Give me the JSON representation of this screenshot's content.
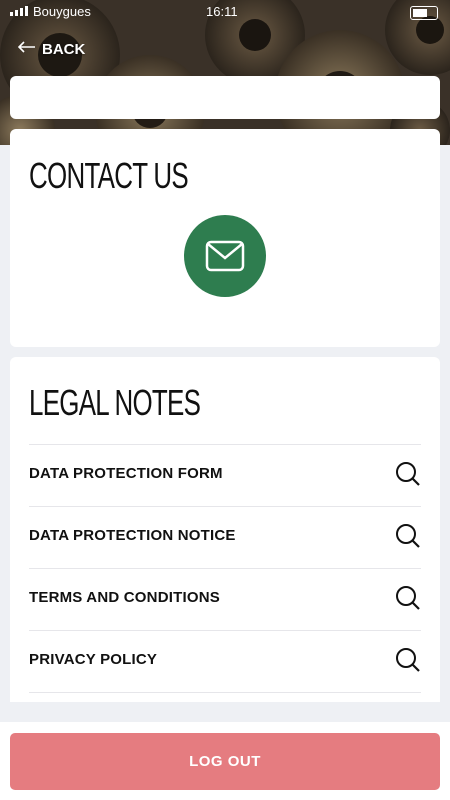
{
  "status_bar": {
    "carrier": "Bouygues",
    "time": "16:11",
    "battery_text": "",
    "signal_icon": "signal-icon",
    "battery_icon": "battery-icon"
  },
  "header": {
    "back_label": "BACK",
    "back_icon": "arrow-left-icon"
  },
  "contact": {
    "title": "CONTACT US",
    "mail_icon": "envelope-icon",
    "mail_button_color": "#2e7d4f"
  },
  "legal": {
    "title": "LEGAL NOTES",
    "items": [
      {
        "label": "DATA PROTECTION FORM",
        "icon": "search-icon"
      },
      {
        "label": "DATA PROTECTION NOTICE",
        "icon": "search-icon"
      },
      {
        "label": "TERMS AND CONDITIONS",
        "icon": "search-icon"
      },
      {
        "label": "PRIVACY POLICY",
        "icon": "search-icon"
      }
    ]
  },
  "footer": {
    "logout_label": "LOG OUT",
    "logout_color": "#e57c80"
  }
}
